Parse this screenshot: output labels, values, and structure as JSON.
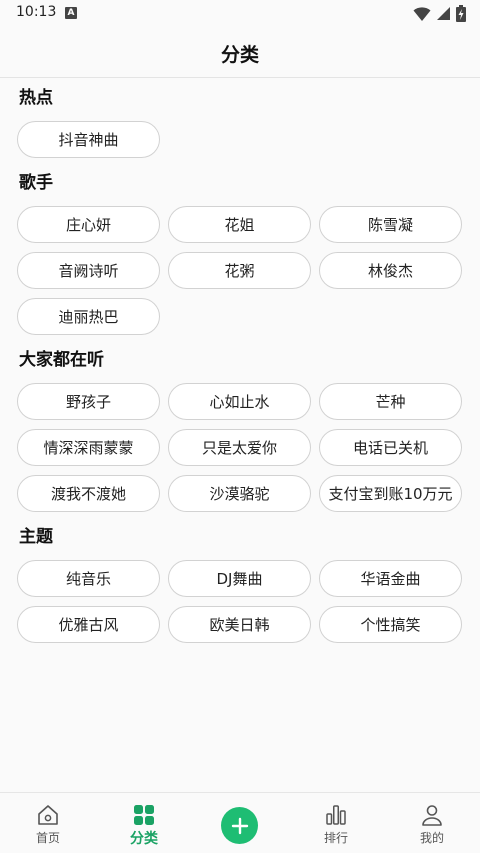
{
  "status": {
    "time": "10:13",
    "notification_icon": "A"
  },
  "header": {
    "title": "分类"
  },
  "sections": [
    {
      "title": "热点",
      "tags": [
        "抖音神曲"
      ]
    },
    {
      "title": "歌手",
      "tags": [
        "庄心妍",
        "花姐",
        "陈雪凝",
        "音阙诗听",
        "花粥",
        "林俊杰",
        "迪丽热巴"
      ]
    },
    {
      "title": "大家都在听",
      "tags": [
        "野孩子",
        "心如止水",
        "芒种",
        "情深深雨蒙蒙",
        "只是太爱你",
        "电话已关机",
        "渡我不渡她",
        "沙漠骆驼",
        "支付宝到账10万元"
      ]
    },
    {
      "title": "主题",
      "tags": [
        "纯音乐",
        "DJ舞曲",
        "华语金曲",
        "优雅古风",
        "欧美日韩",
        "个性搞笑"
      ]
    }
  ],
  "nav": {
    "items": [
      {
        "label": "首页",
        "icon": "home-icon"
      },
      {
        "label": "分类",
        "icon": "category-grid-icon",
        "active": true
      },
      {
        "label": "",
        "icon": "add-icon"
      },
      {
        "label": "排行",
        "icon": "ranking-bars-icon"
      },
      {
        "label": "我的",
        "icon": "profile-icon"
      }
    ]
  },
  "colors": {
    "accent": "#1aa264",
    "add_button": "#1ebd73",
    "divider": "#e4e4e4"
  }
}
